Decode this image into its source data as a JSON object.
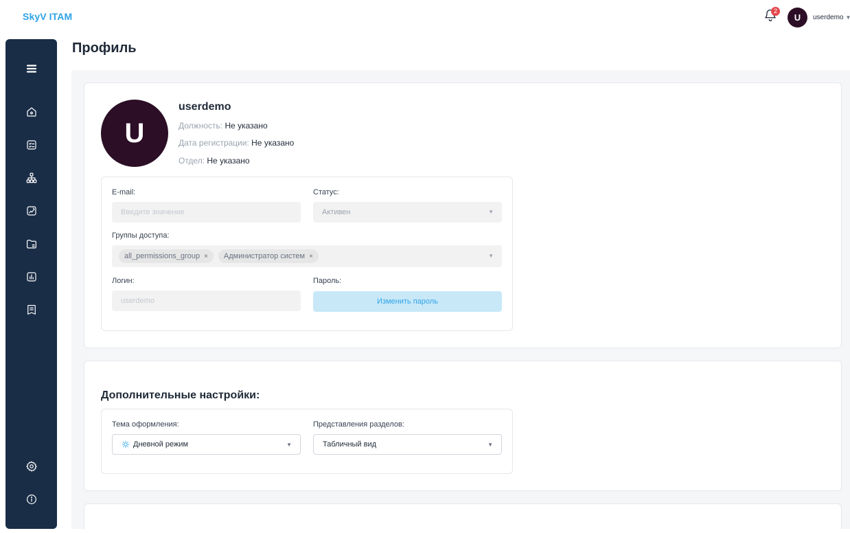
{
  "app": {
    "brand": "SkyV ITAM"
  },
  "header": {
    "notification_count": "2",
    "user_initial": "U",
    "user_name": "userdemo"
  },
  "sidebar": {
    "items": [
      {
        "icon": "menu-icon"
      },
      {
        "icon": "home-icon"
      },
      {
        "icon": "checklist-icon"
      },
      {
        "icon": "hierarchy-icon"
      },
      {
        "icon": "edit-chart-icon"
      },
      {
        "icon": "folder-icon"
      },
      {
        "icon": "bar-chart-icon"
      },
      {
        "icon": "document-icon"
      },
      {
        "icon": "gear-icon"
      },
      {
        "icon": "info-icon"
      }
    ]
  },
  "page": {
    "title": "Профиль"
  },
  "profile": {
    "initial": "U",
    "name": "userdemo",
    "position_label": "Должность:",
    "position_value": "Не указано",
    "registered_label": "Дата регистрации:",
    "registered_value": "Не указано",
    "department_label": "Отдел:",
    "department_value": "Не указано"
  },
  "form": {
    "email_label": "E-mail:",
    "email_placeholder": "Введите значение",
    "status_label": "Статус:",
    "status_value": "Активен",
    "groups_label": "Группы доступа:",
    "groups": [
      "all_permissions_group",
      "Администратор систем"
    ],
    "login_label": "Логин:",
    "login_value": "userdemo",
    "password_label": "Пароль:",
    "change_password": "Изменить пароль"
  },
  "extra": {
    "title": "Дополнительные настройки:",
    "theme_label": "Тема оформления:",
    "theme_value": "Дневной режим",
    "view_label": "Представления разделов:",
    "view_value": "Табличный вид"
  },
  "colors": {
    "accent": "#2ea3e6",
    "sidebar": "#1a2d47",
    "avatar": "#2c0e26",
    "badge": "#e5484d"
  }
}
